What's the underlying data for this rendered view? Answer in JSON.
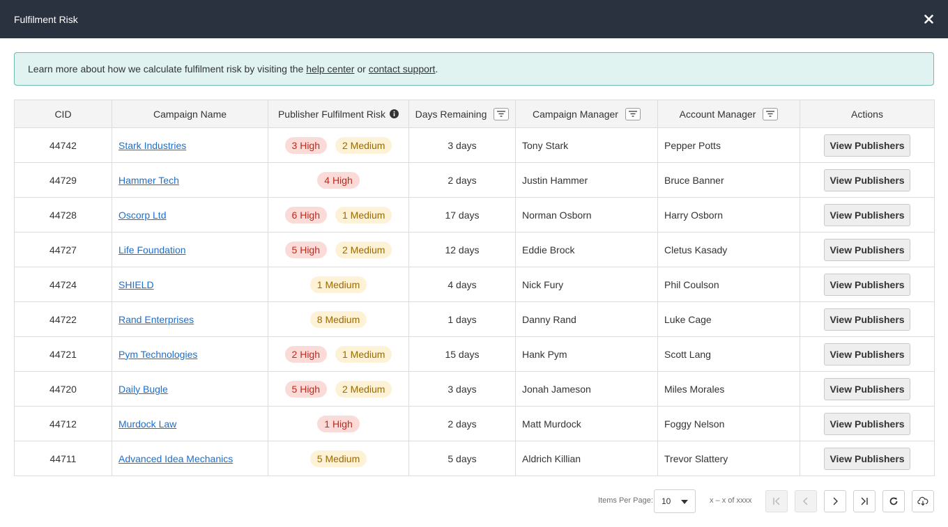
{
  "dialog": {
    "title": "Fulfilment Risk",
    "close_icon": "close-icon"
  },
  "banner": {
    "text_before": "Learn more about how we calculate fulfilment risk by visiting the ",
    "help_link": "help center",
    "text_middle": " or ",
    "support_link": "contact support",
    "text_after": "."
  },
  "table": {
    "headers": {
      "cid": "CID",
      "campaign_name": "Campaign Name",
      "risk": "Publisher Fulfilment Risk",
      "days_remaining": "Days Remaining",
      "campaign_manager": "Campaign Manager",
      "account_manager": "Account Manager",
      "actions": "Actions"
    },
    "action_label": "View Publishers",
    "rows": [
      {
        "cid": "44742",
        "name": "Stark Industries",
        "high": "3 High",
        "medium": "2 Medium",
        "days": "3 days",
        "cm": "Tony Stark",
        "am": "Pepper Potts"
      },
      {
        "cid": "44729",
        "name": "Hammer Tech",
        "high": "4 High",
        "medium": "",
        "days": "2 days",
        "cm": "Justin Hammer",
        "am": "Bruce Banner"
      },
      {
        "cid": "44728",
        "name": "Oscorp Ltd",
        "high": "6 High",
        "medium": "1 Medium",
        "days": "17 days",
        "cm": "Norman Osborn",
        "am": "Harry Osborn"
      },
      {
        "cid": "44727",
        "name": "Life Foundation",
        "high": "5 High",
        "medium": "2 Medium",
        "days": "12 days",
        "cm": "Eddie Brock",
        "am": "Cletus Kasady"
      },
      {
        "cid": "44724",
        "name": "SHIELD",
        "high": "",
        "medium": "1 Medium",
        "days": "4 days",
        "cm": "Nick Fury",
        "am": "Phil Coulson"
      },
      {
        "cid": "44722",
        "name": "Rand Enterprises",
        "high": "",
        "medium": "8 Medium",
        "days": "1 days",
        "cm": "Danny Rand",
        "am": "Luke Cage"
      },
      {
        "cid": "44721",
        "name": "Pym Technologies",
        "high": "2 High",
        "medium": "1 Medium",
        "days": "15 days",
        "cm": "Hank Pym",
        "am": "Scott Lang"
      },
      {
        "cid": "44720",
        "name": "Daily Bugle",
        "high": "5 High",
        "medium": "2 Medium",
        "days": "3 days",
        "cm": "Jonah Jameson",
        "am": "Miles Morales"
      },
      {
        "cid": "44712",
        "name": "Murdock Law",
        "high": "1 High",
        "medium": "",
        "days": "2 days",
        "cm": "Matt Murdock",
        "am": "Foggy Nelson"
      },
      {
        "cid": "44711",
        "name": "Advanced Idea Mechanics",
        "high": "",
        "medium": "5 Medium",
        "days": "5 days",
        "cm": "Aldrich Killian",
        "am": "Trevor Slattery"
      }
    ]
  },
  "pagination": {
    "items_per_page_label": "Items Per Page:",
    "items_per_page_value": "10",
    "range_text": "x – x of xxxx"
  },
  "colors": {
    "titlebar": "#2b323f",
    "banner_bg": "#e1f3f1",
    "banner_border": "#6fb8ad",
    "link": "#1a6fd1",
    "high_bg": "#fadbd8",
    "high_text": "#c0281b",
    "medium_bg": "#fdf1d6",
    "medium_text": "#9a6a00"
  }
}
